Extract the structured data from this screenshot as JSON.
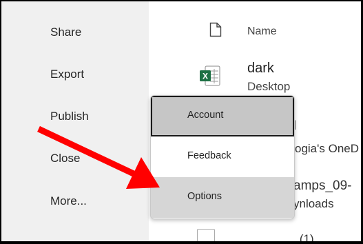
{
  "sidebar": {
    "items": [
      {
        "label": "Share"
      },
      {
        "label": "Export"
      },
      {
        "label": "Publish"
      },
      {
        "label": "Close"
      },
      {
        "label": "More..."
      }
    ]
  },
  "file_list": {
    "header_name": "Name",
    "files": [
      {
        "name": "dark",
        "location": "Desktop",
        "icon": "excel-icon"
      }
    ],
    "partial_texts": [
      "l",
      "ogia's OneD",
      "amps_09-",
      "ynloads",
      "... (1)"
    ]
  },
  "context_menu": {
    "items": [
      {
        "label": "Account",
        "state": "focused"
      },
      {
        "label": "Feedback"
      },
      {
        "label": "Options",
        "state": "hovered"
      }
    ]
  },
  "colors": {
    "annotation_arrow": "#ff0000",
    "excel_green": "#1d7044"
  }
}
